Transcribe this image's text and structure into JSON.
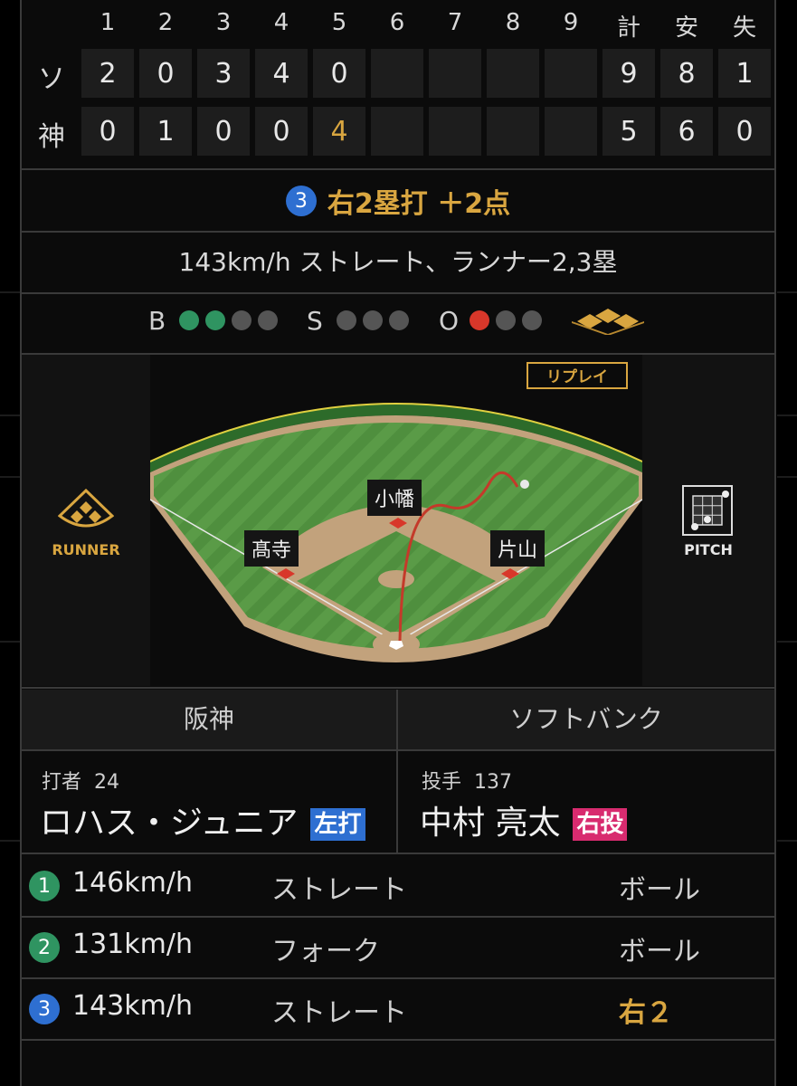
{
  "scoreboard": {
    "headers": [
      "1",
      "2",
      "3",
      "4",
      "5",
      "6",
      "7",
      "8",
      "9",
      "計",
      "安",
      "失"
    ],
    "teams": [
      {
        "abbr": "ソ",
        "innings": [
          "2",
          "0",
          "3",
          "4",
          "0",
          "",
          "",
          "",
          ""
        ],
        "totals": [
          "9",
          "8",
          "1"
        ]
      },
      {
        "abbr": "神",
        "innings": [
          "0",
          "1",
          "0",
          "0",
          "4",
          "",
          "",
          "",
          ""
        ],
        "totals": [
          "5",
          "6",
          "0"
        ]
      }
    ]
  },
  "play": {
    "number": "3",
    "text": "右2塁打 ＋2点"
  },
  "pitch_description": "143km/h ストレート、ランナー2,3塁",
  "count": {
    "ball_label": "B",
    "balls": 2,
    "ball_max": 4,
    "strike_label": "S",
    "strikes": 0,
    "strike_max": 3,
    "out_label": "O",
    "outs": 1,
    "out_max": 3,
    "colors": {
      "ball": "#2f9461",
      "strike": "#d9a640",
      "out": "#d8372a",
      "off": "#555555"
    }
  },
  "field": {
    "replay_label": "リプレイ",
    "runner_label": "RUNNER",
    "pitch_label": "PITCH",
    "fielders": {
      "second": "小幡",
      "third": "髙寺",
      "first": "片山"
    }
  },
  "matchup": {
    "batting_team": "阪神",
    "pitching_team": "ソフトバンク",
    "batter": {
      "role": "打者",
      "number": "24",
      "name": "ロハス・ジュニア",
      "hand": "左打"
    },
    "pitcher": {
      "role": "投手",
      "number": "137",
      "name": "中村 亮太",
      "hand": "右投"
    }
  },
  "pitches": [
    {
      "num": "1",
      "speed": "146km/h",
      "type": "ストレート",
      "result": "ボール",
      "color": "green"
    },
    {
      "num": "2",
      "speed": "131km/h",
      "type": "フォーク",
      "result": "ボール",
      "color": "green"
    },
    {
      "num": "3",
      "speed": "143km/h",
      "type": "ストレート",
      "result": "右２",
      "color": "blue"
    }
  ],
  "colors": {
    "accent": "#d9a640",
    "blue": "#2e6fd1",
    "green": "#2f9461",
    "pink": "#d82b6f"
  }
}
